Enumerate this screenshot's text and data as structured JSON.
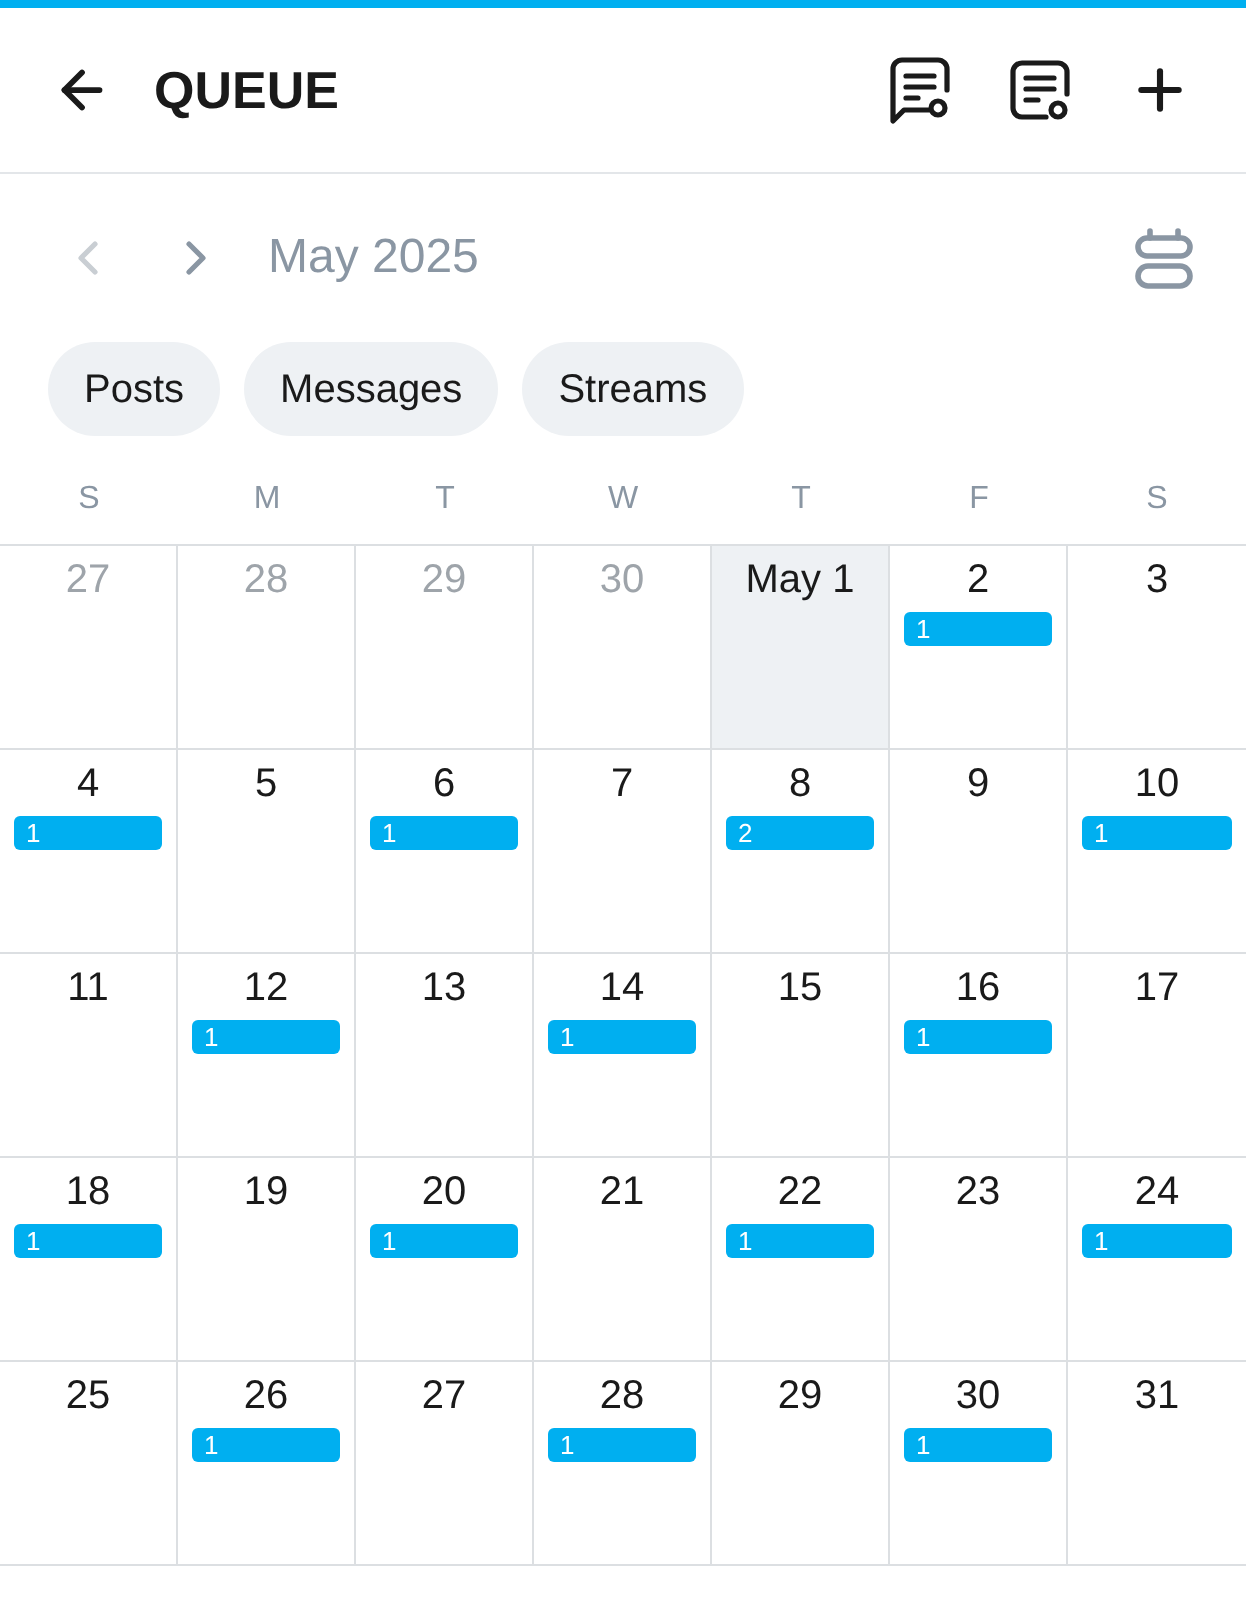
{
  "header": {
    "title": "QUEUE"
  },
  "month_nav": {
    "prev": {
      "disabled": true
    },
    "next": {
      "disabled": false
    },
    "label": "May 2025"
  },
  "filters": [
    {
      "label": "Posts",
      "selected": false
    },
    {
      "label": "Messages",
      "selected": false
    },
    {
      "label": "Streams",
      "selected": false
    }
  ],
  "weekdays": [
    "S",
    "M",
    "T",
    "W",
    "T",
    "F",
    "S"
  ],
  "weeks": [
    {
      "days": [
        {
          "day": "27",
          "outside": true,
          "today": false
        },
        {
          "day": "28",
          "outside": true,
          "today": false
        },
        {
          "day": "29",
          "outside": true,
          "today": false
        },
        {
          "day": "30",
          "outside": true,
          "today": false
        },
        {
          "day": "May 1",
          "outside": false,
          "today": true
        },
        {
          "day": "2",
          "outside": false,
          "today": false,
          "queued": "1"
        },
        {
          "day": "3",
          "outside": false,
          "today": false
        }
      ]
    },
    {
      "days": [
        {
          "day": "4",
          "outside": false,
          "today": false,
          "queued": "1"
        },
        {
          "day": "5",
          "outside": false,
          "today": false
        },
        {
          "day": "6",
          "outside": false,
          "today": false,
          "queued": "1"
        },
        {
          "day": "7",
          "outside": false,
          "today": false
        },
        {
          "day": "8",
          "outside": false,
          "today": false,
          "queued": "2"
        },
        {
          "day": "9",
          "outside": false,
          "today": false
        },
        {
          "day": "10",
          "outside": false,
          "today": false,
          "queued": "1"
        }
      ]
    },
    {
      "days": [
        {
          "day": "11",
          "outside": false,
          "today": false
        },
        {
          "day": "12",
          "outside": false,
          "today": false,
          "queued": "1"
        },
        {
          "day": "13",
          "outside": false,
          "today": false
        },
        {
          "day": "14",
          "outside": false,
          "today": false,
          "queued": "1"
        },
        {
          "day": "15",
          "outside": false,
          "today": false
        },
        {
          "day": "16",
          "outside": false,
          "today": false,
          "queued": "1"
        },
        {
          "day": "17",
          "outside": false,
          "today": false
        }
      ]
    },
    {
      "days": [
        {
          "day": "18",
          "outside": false,
          "today": false,
          "queued": "1"
        },
        {
          "day": "19",
          "outside": false,
          "today": false
        },
        {
          "day": "20",
          "outside": false,
          "today": false,
          "queued": "1"
        },
        {
          "day": "21",
          "outside": false,
          "today": false
        },
        {
          "day": "22",
          "outside": false,
          "today": false,
          "queued": "1"
        },
        {
          "day": "23",
          "outside": false,
          "today": false
        },
        {
          "day": "24",
          "outside": false,
          "today": false,
          "queued": "1"
        }
      ]
    },
    {
      "days": [
        {
          "day": "25",
          "outside": false,
          "today": false
        },
        {
          "day": "26",
          "outside": false,
          "today": false,
          "queued": "1"
        },
        {
          "day": "27",
          "outside": false,
          "today": false
        },
        {
          "day": "28",
          "outside": false,
          "today": false,
          "queued": "1"
        },
        {
          "day": "29",
          "outside": false,
          "today": false
        },
        {
          "day": "30",
          "outside": false,
          "today": false,
          "queued": "1"
        },
        {
          "day": "31",
          "outside": false,
          "today": false
        }
      ]
    }
  ]
}
